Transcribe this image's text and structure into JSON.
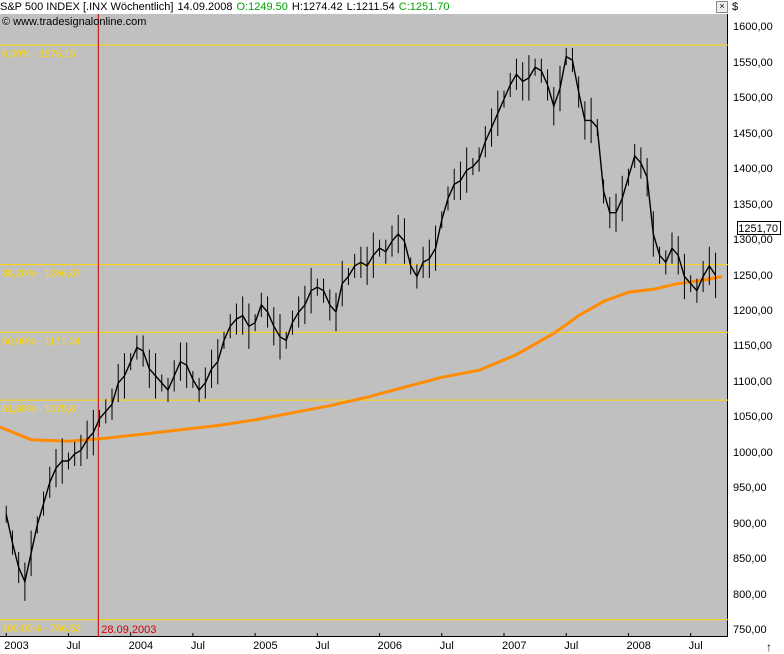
{
  "header": {
    "symbol": "S&P 500 INDEX [.INX  Wöchentlich]",
    "date": "14.09.2008",
    "open": "O:1249.50",
    "high": "H:1274.42",
    "low": "L:1211.54",
    "close": "C:1251.70",
    "close_color": "#00a000",
    "open_color": "#00a000"
  },
  "watermark": "© www.tradesignalonline.com",
  "currency_symbol": "$",
  "current_price_label": "1251,70",
  "window_buttons": {
    "close": "×"
  },
  "colors": {
    "background": "#c0c0c0",
    "fib_line": "#ffd700",
    "moving_average": "#ff8c00",
    "vertical_marker": "#cc0000",
    "candles": "#000000"
  },
  "chart_data": {
    "type": "line",
    "title": "S&P 500 INDEX",
    "xlabel": "",
    "ylabel": "",
    "ylim": [
      742,
      1620
    ],
    "y_ticks": [
      "1600,00",
      "1550,00",
      "1500,00",
      "1450,00",
      "1400,00",
      "1350,00",
      "1300,00",
      "1250,00",
      "1200,00",
      "1150,00",
      "1100,00",
      "1050,00",
      "1000,00",
      "950,00",
      "900,00",
      "850,00",
      "800,00",
      "750,00"
    ],
    "x_ticks": [
      "2003",
      "Jul",
      "2004",
      "Jul",
      "2005",
      "Jul",
      "2006",
      "Jul",
      "2007",
      "Jul",
      "2008",
      "Jul"
    ],
    "xlim": [
      2002.95,
      2008.8
    ],
    "fibonacci_levels": [
      {
        "label": "0,00% - 1576,15",
        "value": 1576.15
      },
      {
        "label": "38,20% - 1266,87",
        "value": 1266.87
      },
      {
        "label": "50,00% - 1171,34",
        "value": 1171.34
      },
      {
        "label": "61,80% - 1075,8",
        "value": 1075.8
      },
      {
        "label": "100,00% - 766,53",
        "value": 766.53
      }
    ],
    "marker": {
      "label": "28.09.2003",
      "x": 2003.74
    },
    "series": [
      {
        "values_x": [
          2003.0,
          2003.05,
          2003.1,
          2003.15,
          2003.2,
          2003.25,
          2003.3,
          2003.35,
          2003.4,
          2003.45,
          2003.5,
          2003.55,
          2003.6,
          2003.65,
          2003.7,
          2003.75,
          2003.8,
          2003.85,
          2003.9,
          2003.95,
          2004.0,
          2004.05,
          2004.1,
          2004.15,
          2004.2,
          2004.25,
          2004.3,
          2004.35,
          2004.4,
          2004.45,
          2004.5,
          2004.55,
          2004.6,
          2004.65,
          2004.7,
          2004.75,
          2004.8,
          2004.85,
          2004.9,
          2004.95,
          2005.0,
          2005.05,
          2005.1,
          2005.15,
          2005.2,
          2005.25,
          2005.3,
          2005.35,
          2005.4,
          2005.45,
          2005.5,
          2005.55,
          2005.6,
          2005.65,
          2005.7,
          2005.75,
          2005.8,
          2005.85,
          2005.9,
          2005.95,
          2006.0,
          2006.05,
          2006.1,
          2006.15,
          2006.2,
          2006.25,
          2006.3,
          2006.35,
          2006.4,
          2006.45,
          2006.5,
          2006.55,
          2006.6,
          2006.65,
          2006.7,
          2006.75,
          2006.8,
          2006.85,
          2006.9,
          2006.95,
          2007.0,
          2007.05,
          2007.1,
          2007.15,
          2007.2,
          2007.25,
          2007.3,
          2007.35,
          2007.4,
          2007.45,
          2007.5,
          2007.55,
          2007.6,
          2007.65,
          2007.7,
          2007.75,
          2007.8,
          2007.85,
          2007.9,
          2007.95,
          2008.0,
          2008.05,
          2008.1,
          2008.15,
          2008.2,
          2008.25,
          2008.3,
          2008.35,
          2008.4,
          2008.45,
          2008.5,
          2008.55,
          2008.6,
          2008.65,
          2008.7
        ],
        "values": [
          915,
          875,
          840,
          820,
          860,
          900,
          930,
          960,
          980,
          990,
          990,
          1000,
          1005,
          1020,
          1030,
          1050,
          1060,
          1070,
          1100,
          1110,
          1130,
          1150,
          1145,
          1120,
          1110,
          1100,
          1090,
          1110,
          1130,
          1125,
          1105,
          1090,
          1100,
          1120,
          1130,
          1160,
          1180,
          1190,
          1195,
          1180,
          1185,
          1210,
          1200,
          1180,
          1165,
          1160,
          1185,
          1200,
          1210,
          1230,
          1235,
          1230,
          1210,
          1200,
          1240,
          1250,
          1265,
          1270,
          1265,
          1280,
          1290,
          1285,
          1300,
          1310,
          1300,
          1265,
          1250,
          1270,
          1275,
          1290,
          1330,
          1360,
          1380,
          1385,
          1400,
          1405,
          1415,
          1440,
          1460,
          1480,
          1500,
          1520,
          1535,
          1525,
          1530,
          1545,
          1540,
          1520,
          1490,
          1515,
          1560,
          1555,
          1510,
          1470,
          1470,
          1460,
          1370,
          1340,
          1340,
          1360,
          1390,
          1420,
          1410,
          1390,
          1310,
          1280,
          1270,
          1290,
          1280,
          1250,
          1240,
          1230,
          1250,
          1265,
          1251.7
        ],
        "name": ""
      },
      {
        "values_x": [
          2002.95,
          2003.2,
          2003.5,
          2003.8,
          2004.1,
          2004.4,
          2004.7,
          2005.0,
          2005.3,
          2005.6,
          2005.9,
          2006.2,
          2006.5,
          2006.8,
          2007.1,
          2007.4,
          2007.6,
          2007.8,
          2008.0,
          2008.2,
          2008.4,
          2008.6,
          2008.75
        ],
        "values": [
          1038,
          1020,
          1018,
          1022,
          1028,
          1034,
          1040,
          1048,
          1058,
          1068,
          1080,
          1094,
          1108,
          1118,
          1140,
          1170,
          1195,
          1215,
          1228,
          1232,
          1240,
          1245,
          1250
        ],
        "name": ""
      }
    ]
  }
}
